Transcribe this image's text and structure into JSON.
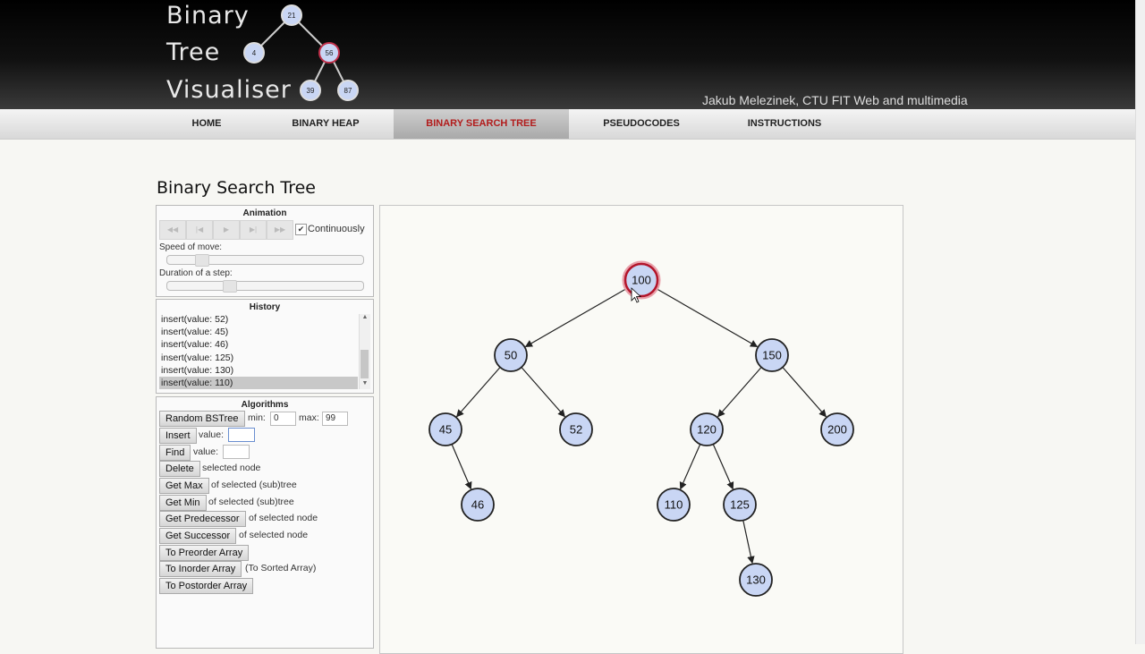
{
  "header": {
    "logo_words": [
      "Binary",
      "Tree",
      "Visualiser"
    ],
    "logo_nodes": [
      "21",
      "4",
      "56",
      "39",
      "87"
    ],
    "author": "Jakub Melezinek, CTU FIT Web and multimedia"
  },
  "nav": {
    "items": [
      {
        "label": "HOME"
      },
      {
        "label": "BINARY HEAP"
      },
      {
        "label": "BINARY SEARCH TREE",
        "active": true
      },
      {
        "label": "PSEUDOCODES"
      },
      {
        "label": "INSTRUCTIONS"
      }
    ]
  },
  "page": {
    "title": "Binary Search Tree"
  },
  "animation": {
    "title": "Animation",
    "continuously_label": "Continuously",
    "continuously_checked": true,
    "speed_label": "Speed of move:",
    "speed_value": 0.15,
    "duration_label": "Duration of a step:",
    "duration_value": 0.3,
    "controls": [
      "rewind-icon",
      "step-back-icon",
      "play-icon",
      "step-forward-icon",
      "fast-forward-icon"
    ]
  },
  "history": {
    "title": "History",
    "items": [
      "insert(value: 52)",
      "insert(value: 45)",
      "insert(value: 46)",
      "insert(value: 125)",
      "insert(value: 130)",
      "insert(value: 110)"
    ],
    "selected_index": 5
  },
  "algorithms": {
    "title": "Algorithms",
    "random_label": "Random BSTree",
    "min_label": "min:",
    "min_value": "0",
    "max_label": "max:",
    "max_value": "99",
    "insert_label": "Insert",
    "insert_value_label": "value:",
    "find_label": "Find",
    "find_value_label": "value:",
    "delete_label": "Delete",
    "delete_desc": "selected node",
    "getmax_label": "Get Max",
    "getmax_desc": "of selected (sub)tree",
    "getmin_label": "Get Min",
    "getmin_desc": "of selected (sub)tree",
    "pred_label": "Get Predecessor",
    "pred_desc": "of selected node",
    "succ_label": "Get Successor",
    "succ_desc": "of selected node",
    "preorder_label": "To Preorder Array",
    "inorder_label": "To Inorder Array",
    "inorder_desc": "(To Sorted Array)",
    "postorder_label": "To Postorder Array"
  },
  "tree": {
    "root": "100",
    "highlighted": "100",
    "nodes": [
      {
        "value": "100",
        "parent": null
      },
      {
        "value": "50",
        "parent": "100"
      },
      {
        "value": "150",
        "parent": "100"
      },
      {
        "value": "45",
        "parent": "50"
      },
      {
        "value": "52",
        "parent": "50"
      },
      {
        "value": "120",
        "parent": "150"
      },
      {
        "value": "200",
        "parent": "150"
      },
      {
        "value": "46",
        "parent": "45"
      },
      {
        "value": "110",
        "parent": "120"
      },
      {
        "value": "125",
        "parent": "120"
      },
      {
        "value": "130",
        "parent": "125"
      }
    ],
    "colors": {
      "node_fill": "#c9d6f4",
      "node_stroke": "#222222",
      "highlight_stroke": "#b3152b",
      "edge": "#222222"
    }
  }
}
